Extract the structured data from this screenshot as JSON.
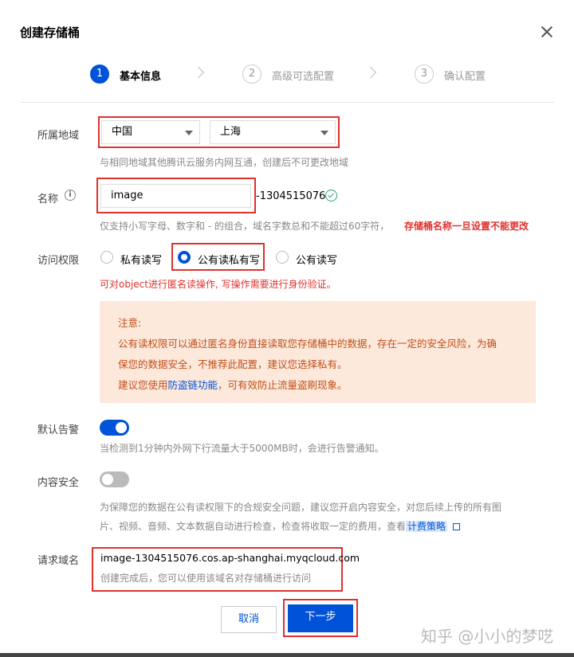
{
  "dialog": {
    "title": "创建存储桶"
  },
  "steps": [
    {
      "number": "1",
      "label": "基本信息"
    },
    {
      "number": "2",
      "label": "高级可选配置"
    },
    {
      "number": "3",
      "label": "确认配置"
    }
  ],
  "region": {
    "label": "所属地域",
    "region_value": "中国",
    "city_value": "上海",
    "hint": "与相同地域其他腾讯云服务内网互通，创建后不可更改地域"
  },
  "name": {
    "label": "名称",
    "value": "image",
    "suffix": "-1304515076",
    "hint": "仅支持小写字母、数字和 - 的组合，域名字数总和不能超过60字符，",
    "warning": "存储桶名称一旦设置不能更改"
  },
  "access": {
    "label": "访问权限",
    "options": [
      "私有读写",
      "公有读私有写",
      "公有读写"
    ],
    "selected": "公有读私有写",
    "desc": "可对object进行匿名读操作, 写操作需要进行身份验证。"
  },
  "notice": {
    "title": "注意:",
    "line1": "公有读权限可以通过匿名身份直接读取您存储桶中的数据，存在一定的安全风险，为确",
    "line2": "保您的数据安全，不推荐此配置，建议您选择私有。",
    "line3_prefix": "建议您使用",
    "line3_link": "防盗链功能",
    "line3_suffix": "，可有效防止流量盗刷现象。"
  },
  "alarm": {
    "label": "默认告警",
    "enabled": true,
    "hint": "当检测到1分钟内外网下行流量大于5000MB时，会进行告警通知。"
  },
  "content_security": {
    "label": "内容安全",
    "enabled": false,
    "hint1": "为保障您的数据在公有读权限下的合规安全问题，建议您开启内容安全，对您后续上传的所有图",
    "hint2": "片、视频、音频、文本数据自动进行检查，检查将收取一定的费用，查看",
    "link": "计费策略"
  },
  "domain": {
    "label": "请求域名",
    "value": "image-1304515076.cos.ap-shanghai.myqcloud.com",
    "hint": "创建完成后，您可以使用该域名对存储桶进行访问"
  },
  "buttons": {
    "cancel": "取消",
    "next": "下一步"
  },
  "watermark": "知乎 @小小的梦呓",
  "colors": {
    "primary": "#0052d9",
    "danger": "#e0312e",
    "notice_bg": "#fde9dc",
    "notice_text": "#c24e1a",
    "success": "#2ba471"
  }
}
